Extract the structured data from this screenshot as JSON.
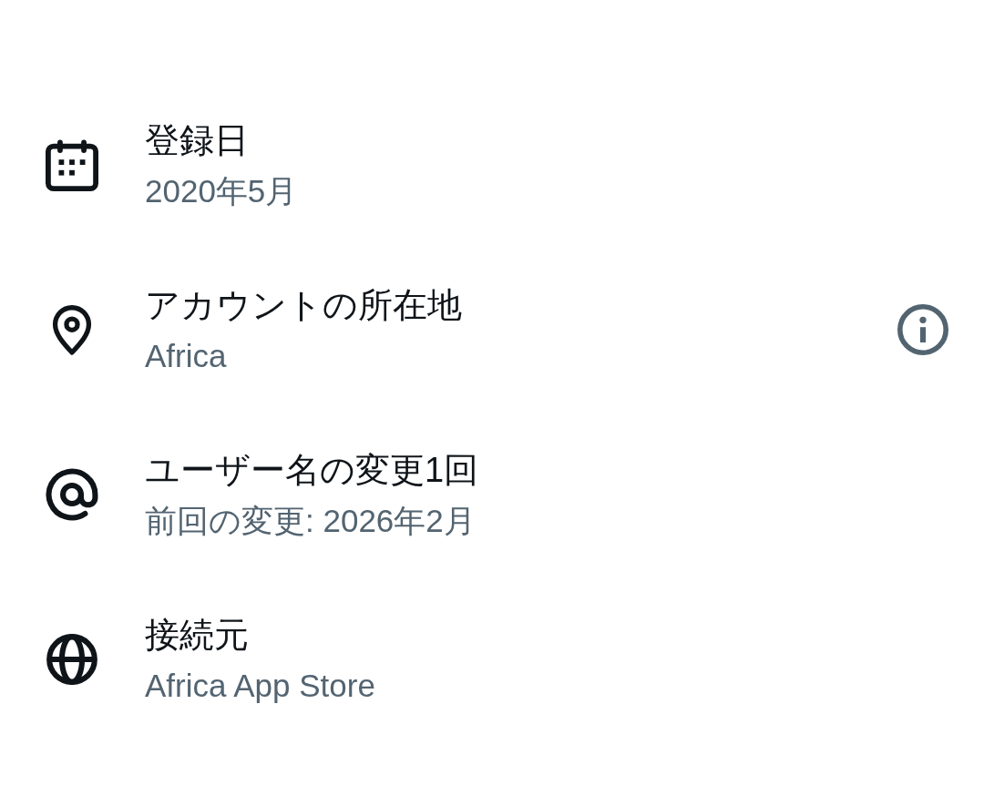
{
  "rows": [
    {
      "kind": "date",
      "title": "登録日",
      "detail": "2020年5月",
      "has_info": false
    },
    {
      "kind": "location",
      "title": "アカウントの所在地",
      "detail": "Africa",
      "has_info": true
    },
    {
      "kind": "username",
      "title": "ユーザー名の変更1回",
      "detail": "前回の変更: 2026年2月",
      "has_info": false
    },
    {
      "kind": "connection",
      "title": "接続元",
      "detail": "Africa App Store",
      "has_info": false
    }
  ]
}
